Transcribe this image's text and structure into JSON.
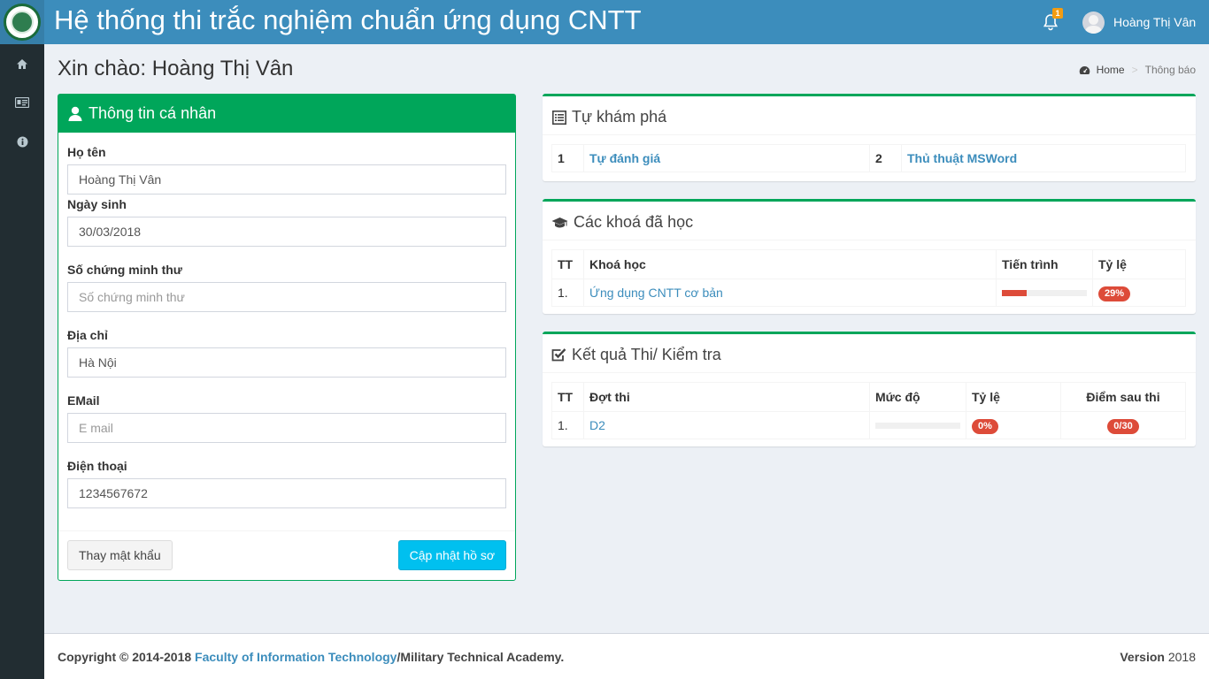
{
  "header": {
    "title": "Hệ thống thi trắc nghiệm chuẩn ứng dụng CNTT",
    "notification_count": "1",
    "user_name": "Hoàng Thị Vân",
    "color": "#3c8dbc"
  },
  "sidebar": {
    "items": [
      {
        "icon": "home-icon"
      },
      {
        "icon": "id-card-icon"
      },
      {
        "icon": "info-circle-icon"
      }
    ]
  },
  "page": {
    "heading": "Xin chào: Hoàng Thị Vân",
    "breadcrumb": {
      "home": "Home",
      "current": "Thông báo"
    }
  },
  "profile": {
    "title": "Thông tin cá nhân",
    "fields": {
      "name": {
        "label": "Họ tên",
        "value": "Hoàng Thị Vân",
        "placeholder": ""
      },
      "birthday": {
        "label": "Ngày sinh",
        "value": "30/03/2018",
        "placeholder": ""
      },
      "id_number": {
        "label": "Số chứng minh thư",
        "value": "",
        "placeholder": "Số chứng minh thư"
      },
      "address": {
        "label": "Địa chỉ",
        "value": "Hà Nội",
        "placeholder": ""
      },
      "email": {
        "label": "EMail",
        "value": "",
        "placeholder": "E mail"
      },
      "phone": {
        "label": "Điện thoại",
        "value": "1234567672",
        "placeholder": ""
      }
    },
    "change_password_label": "Thay mật khẩu",
    "update_label": "Cập nhật hồ sơ"
  },
  "explore": {
    "title": "Tự khám phá",
    "items": [
      {
        "no": "1",
        "label": "Tự đánh giá"
      },
      {
        "no": "2",
        "label": "Thủ thuật MSWord"
      }
    ]
  },
  "courses": {
    "title": "Các khoá đã học",
    "headers": {
      "no": "TT",
      "name": "Khoá học",
      "progress": "Tiến trình",
      "rate": "Tỷ lệ"
    },
    "rows": [
      {
        "no": "1.",
        "name": "Ứng dụng CNTT cơ bản",
        "progress_pct": 29,
        "rate": "29%"
      }
    ]
  },
  "results": {
    "title": "Kết quả Thi/ Kiểm tra",
    "headers": {
      "no": "TT",
      "exam": "Đợt thi",
      "level": "Mức độ",
      "rate": "Tỷ lệ",
      "score": "Điểm sau thi"
    },
    "rows": [
      {
        "no": "1.",
        "exam": "D2",
        "level_pct": 0,
        "rate": "0%",
        "score": "0/30"
      }
    ]
  },
  "footer": {
    "copyright": "Copyright © 2014-2018 ",
    "org_link": "Faculty of Information Technology",
    "org_rest": "/Military Technical Academy.",
    "version_label": "Version",
    "version_value": " 2018"
  }
}
